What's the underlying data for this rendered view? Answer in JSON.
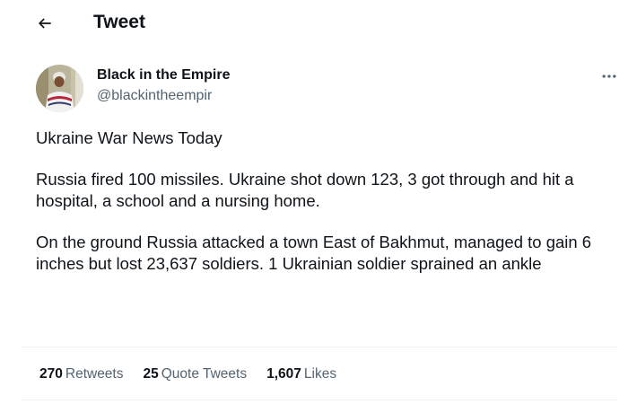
{
  "header": {
    "title": "Tweet",
    "back_icon": "arrow-left-icon"
  },
  "author": {
    "name": "Black in the Empire",
    "handle": "@blackintheempir"
  },
  "tweet": {
    "paragraphs": [
      "Ukraine War News Today",
      "Russia fired 100 missiles. Ukraine shot down 123, 3 got through and hit a hospital, a school and a nursing home.",
      "On the ground Russia attacked a town East of Bakhmut, managed to gain 6 inches but lost 23,637 soldiers. 1 Ukrainian soldier sprained an ankle"
    ]
  },
  "stats": {
    "retweets": {
      "count": "270",
      "label": "Retweets"
    },
    "quote_tweets": {
      "count": "25",
      "label": "Quote Tweets"
    },
    "likes": {
      "count": "1,607",
      "label": "Likes"
    }
  },
  "colors": {
    "text_primary": "#0f1419",
    "text_secondary": "#536471",
    "divider": "#eff3f4"
  }
}
